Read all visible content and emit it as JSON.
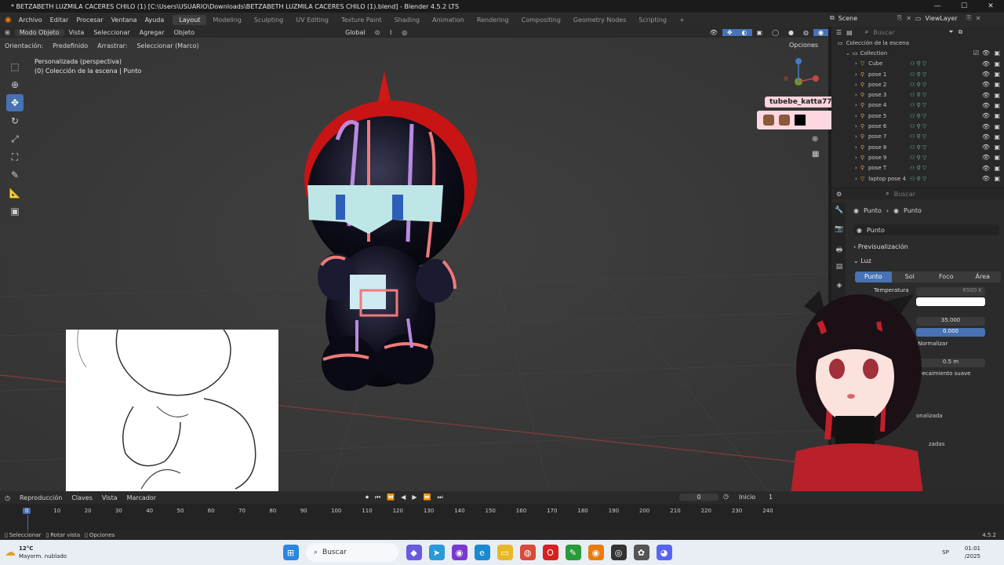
{
  "window": {
    "title": "* BETZABETH LUZMILA CACERES CHILO (1) [C:\\Users\\USUARIO\\Downloads\\BETZABETH LUZMILA CACERES CHILO (1).blend] - Blender 4.5.2 LTS",
    "min": "—",
    "max": "☐",
    "close": "✕"
  },
  "menu": {
    "items": [
      "Archivo",
      "Editar",
      "Procesar",
      "Ventana",
      "Ayuda"
    ],
    "workspaces": [
      "Layout",
      "Modeling",
      "Sculpting",
      "UV Editing",
      "Texture Paint",
      "Shading",
      "Animation",
      "Rendering",
      "Compositing",
      "Geometry Nodes",
      "Scripting",
      "+"
    ],
    "active_workspace": 0,
    "scene_label": "Scene",
    "viewlayer_label": "ViewLayer"
  },
  "viewport_header": {
    "mode": "Modo Objeto",
    "items": [
      "Vista",
      "Seleccionar",
      "Agregar",
      "Objeto"
    ],
    "orientation": "Global"
  },
  "tool_header": {
    "orientation_label": "Orientación:",
    "orientation_value": "Predefinido",
    "drag_label": "Arrastrar:",
    "drag_value": "Seleccionar (Marco)",
    "options": "Opciones"
  },
  "viewport": {
    "view_name": "Personalizada (perspectiva)",
    "collection_info": "(0) Colección de la escena | Punto"
  },
  "overlay": {
    "username": "tubebe_katta77"
  },
  "outliner": {
    "search_placeholder": "Buscar",
    "root": "Colección de la escena",
    "collection": "Collection",
    "items": [
      "Cube",
      "pose 1",
      "pose 2",
      "pose 3",
      "pose 4",
      "pose 5",
      "pose 6",
      "pose 7",
      "pose 8",
      "pose 9",
      "pose T",
      "laptop pose 4"
    ]
  },
  "properties": {
    "search_placeholder": "Buscar",
    "breadcrumb_obj": "Punto",
    "breadcrumb_data": "Punto",
    "data_name": "Punto",
    "section_preview": "Previsualización",
    "section_light": "Luz",
    "light_types": [
      "Punto",
      "Sol",
      "Foco",
      "Área"
    ],
    "active_light_type": 0,
    "temperature_label": "Temperatura",
    "temperature_value": "6500 K",
    "power_value": "35.000",
    "value2": "0.000",
    "normalize_label": "Normalizar",
    "radius_value": "0.5 m",
    "soft_falloff_label": "Decaimiento suave",
    "partial1": "onalizada",
    "partial2": "zadas"
  },
  "timeline": {
    "menus": [
      "Reproducción",
      "Claves",
      "Vista",
      "Marcador"
    ],
    "current_frame": "0",
    "start_label": "Inicio",
    "start_value": "1",
    "ticks": [
      "0",
      "10",
      "20",
      "30",
      "40",
      "50",
      "60",
      "70",
      "80",
      "90",
      "100",
      "110",
      "120",
      "130",
      "140",
      "150",
      "160",
      "170",
      "180",
      "190",
      "200",
      "210",
      "220",
      "230",
      "240"
    ],
    "playhead_frame": 0
  },
  "statusbar": {
    "items": [
      "Seleccionar",
      "Rotar vista",
      "Opciones"
    ],
    "version": "4.5.2"
  },
  "taskbar": {
    "weather_temp": "12°C",
    "weather_desc": "Mayorm. nublado",
    "search_placeholder": "Buscar",
    "time": "01:01",
    "date": "/2025",
    "lang": "SP"
  }
}
